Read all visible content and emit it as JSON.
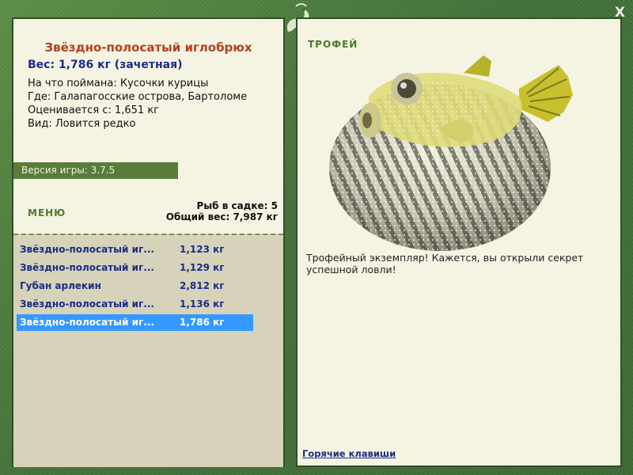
{
  "fish": {
    "title": "Звёздно-полосатый иглобрюх",
    "weight_line": "Вес: 1,786 кг (зачетная)",
    "caught_on": "На что поймана: Кусочки курицы",
    "location": "Где: Галапагосские острова, Бартоломе",
    "valued_from": "Оценивается с: 1,651 кг",
    "rarity": "Вид: Ловится редко"
  },
  "version": "Версия игры: 3.7.5",
  "menu_label": "МЕНЮ",
  "keep": {
    "count": "Рыб в садке: 5",
    "total": "Общий вес: 7,987 кг"
  },
  "catch_list": [
    {
      "name": "Звёздно-полосатый иг...",
      "weight": "1,123 кг"
    },
    {
      "name": "Звёздно-полосатый иг...",
      "weight": "1,129 кг"
    },
    {
      "name": "Губан арлекин",
      "weight": "2,812 кг"
    },
    {
      "name": "Звёздно-полосатый иг...",
      "weight": "1,136 кг"
    },
    {
      "name": "Звёздно-полосатый иг...",
      "weight": "1,786 кг",
      "selected": true
    }
  ],
  "trophy_label": "ТРОФЕЙ",
  "description": "Трофейный экземпляр! Кажется, вы открыли секрет успешной ловли!",
  "hotkeys": "Горячие клавиши",
  "close_label": "X",
  "colors": {
    "frame": "#4a7a3a",
    "title_red": "#b5401f",
    "text_blue": "#1b2c85",
    "selection": "#3399ff"
  }
}
